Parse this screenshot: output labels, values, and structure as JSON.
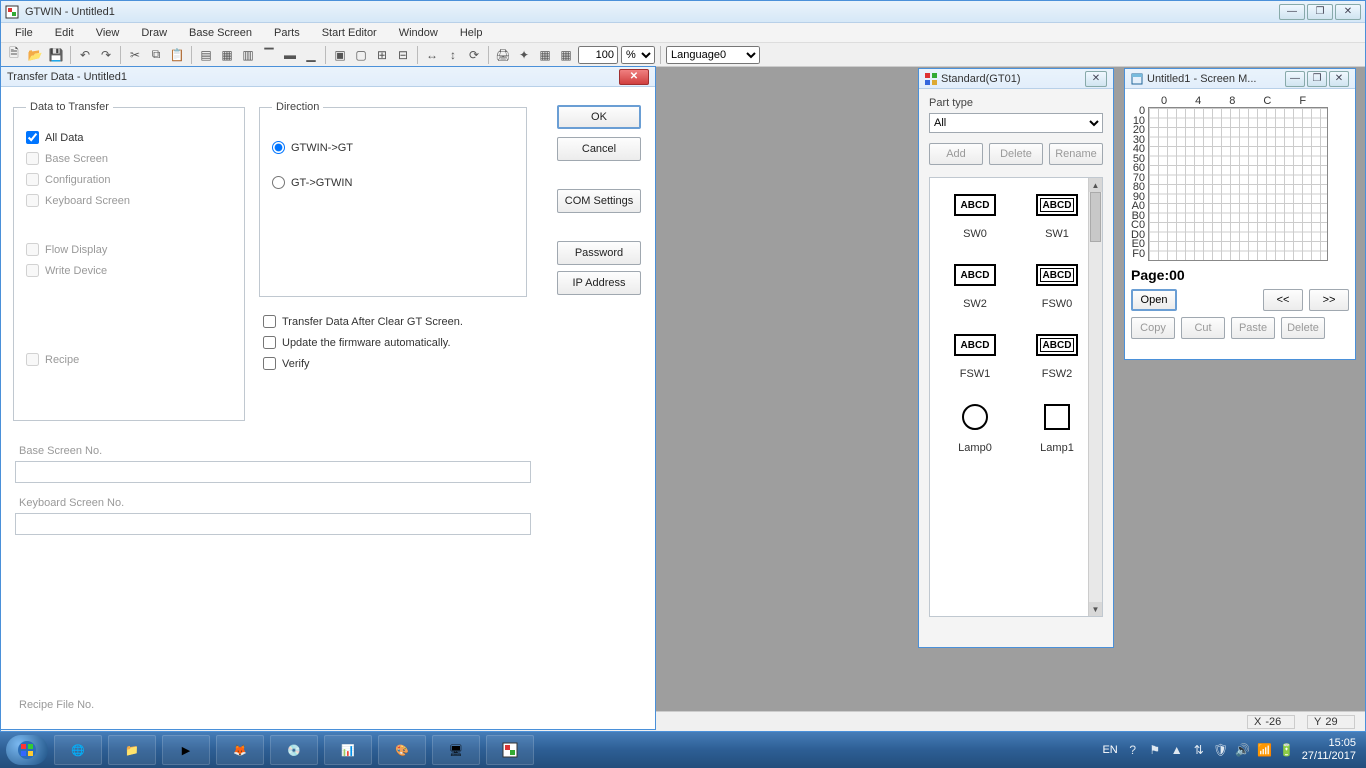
{
  "app": {
    "title": "GTWIN - Untitled1"
  },
  "menu": {
    "file": "File",
    "edit": "Edit",
    "view": "View",
    "draw": "Draw",
    "basescreen": "Base Screen",
    "parts": "Parts",
    "starteditor": "Start Editor",
    "window": "Window",
    "help": "Help"
  },
  "toolbar": {
    "zoom": "100",
    "zoom_pct": "%",
    "language": "Language0"
  },
  "dialog": {
    "title": "Transfer Data - Untitled1",
    "data_to_transfer": {
      "legend": "Data to Transfer",
      "all_data": "All Data",
      "base_screen": "Base Screen",
      "configuration": "Configuration",
      "keyboard_screen": "Keyboard Screen",
      "flow_display": "Flow Display",
      "write_device": "Write Device",
      "recipe": "Recipe"
    },
    "direction": {
      "legend": "Direction",
      "gtwin_gt": "GTWIN->GT",
      "gt_gtwin": "GT->GTWIN"
    },
    "opts": {
      "clear": "Transfer Data After Clear GT Screen.",
      "firmware": "Update the firmware automatically.",
      "verify": "Verify"
    },
    "buttons": {
      "ok": "OK",
      "cancel": "Cancel",
      "com": "COM Settings",
      "password": "Password",
      "ip": "IP Address"
    },
    "labels": {
      "base_no": "Base Screen No.",
      "kbd_no": "Keyboard Screen No.",
      "recipe_no": "Recipe File No."
    }
  },
  "palette": {
    "title": "Standard(GT01)",
    "part_type_label": "Part type",
    "part_type_value": "All",
    "add": "Add",
    "delete": "Delete",
    "rename": "Rename",
    "items": [
      {
        "label": "SW0",
        "glyph": "ABCD",
        "style": "plain"
      },
      {
        "label": "SW1",
        "glyph": "ABCD",
        "style": "thick"
      },
      {
        "label": "SW2",
        "glyph": "ABCD",
        "style": "plain"
      },
      {
        "label": "FSW0",
        "glyph": "ABCD",
        "style": "thick"
      },
      {
        "label": "FSW1",
        "glyph": "ABCD",
        "style": "plain"
      },
      {
        "label": "FSW2",
        "glyph": "ABCD",
        "style": "thick"
      },
      {
        "label": "Lamp0",
        "glyph": "",
        "style": "round"
      },
      {
        "label": "Lamp1",
        "glyph": "",
        "style": "square"
      }
    ]
  },
  "scrmgr": {
    "title": "Untitled1 - Screen M...",
    "cols": [
      "0",
      "4",
      "8",
      "C",
      "F"
    ],
    "rows": [
      "0",
      "10",
      "20",
      "30",
      "40",
      "50",
      "60",
      "70",
      "80",
      "90",
      "A0",
      "B0",
      "C0",
      "D0",
      "E0",
      "F0"
    ],
    "page": "Page:00",
    "open": "Open",
    "prev": "<<",
    "next": ">>",
    "copy": "Copy",
    "cut": "Cut",
    "paste": "Paste",
    "delete": "Delete"
  },
  "status": {
    "x_lbl": "X",
    "x_val": "-26",
    "y_lbl": "Y",
    "y_val": "29"
  },
  "taskbar": {
    "lang": "EN",
    "time": "15:05",
    "date": "27/11/2017"
  }
}
